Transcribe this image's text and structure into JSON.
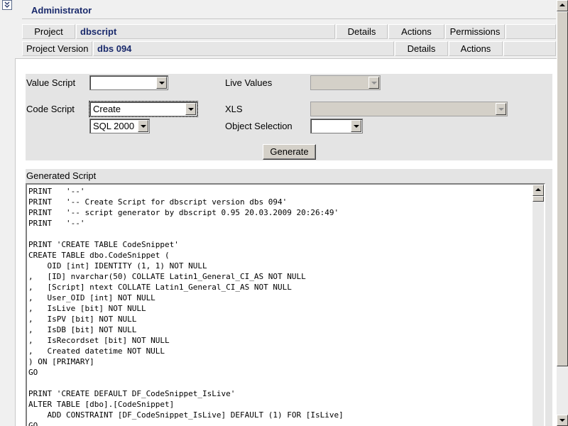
{
  "header": {
    "admin_title": "Administrator",
    "project_row": {
      "label": "Project",
      "value": "dbscript",
      "details": "Details",
      "actions": "Actions",
      "permissions": "Permissions"
    },
    "version_row": {
      "label": "Project Version",
      "value": "dbs 094",
      "details": "Details",
      "actions": "Actions"
    }
  },
  "form": {
    "value_script_label": "Value Script",
    "value_script_selected": "",
    "live_values_label": "Live Values",
    "live_values_selected": "",
    "code_script_label": "Code Script",
    "code_script_selected": "Create",
    "sql_version_selected": "SQL 2000",
    "xls_label": "XLS",
    "xls_selected": "",
    "object_selection_label": "Object Selection",
    "object_selection_selected": "",
    "generate_label": "Generate"
  },
  "generated": {
    "label": "Generated Script",
    "script": "PRINT   '--'\nPRINT   '-- Create Script for dbscript version dbs 094'\nPRINT   '-- script generator by dbscript 0.95 20.03.2009 20:26:49'\nPRINT   '--'\n\nPRINT 'CREATE TABLE CodeSnippet'\nCREATE TABLE dbo.CodeSnippet (\n    OID [int] IDENTITY (1, 1) NOT NULL\n,   [ID] nvarchar(50) COLLATE Latin1_General_CI_AS NOT NULL\n,   [Script] ntext COLLATE Latin1_General_CI_AS NOT NULL\n,   User_OID [int] NOT NULL\n,   IsLive [bit] NOT NULL\n,   IsPV [bit] NOT NULL\n,   IsDB [bit] NOT NULL\n,   IsRecordset [bit] NOT NULL\n,   Created datetime NOT NULL\n) ON [PRIMARY]\nGO\n\nPRINT 'CREATE DEFAULT DF_CodeSnippet_IsLive'\nALTER TABLE [dbo].[CodeSnippet]\n    ADD CONSTRAINT [DF_CodeSnippet_IsLive] DEFAULT (1) FOR [IsLive]\nGO"
  },
  "icons": {
    "collapse": "double-chevron-down-icon",
    "dropdown": "chevron-down-icon"
  }
}
